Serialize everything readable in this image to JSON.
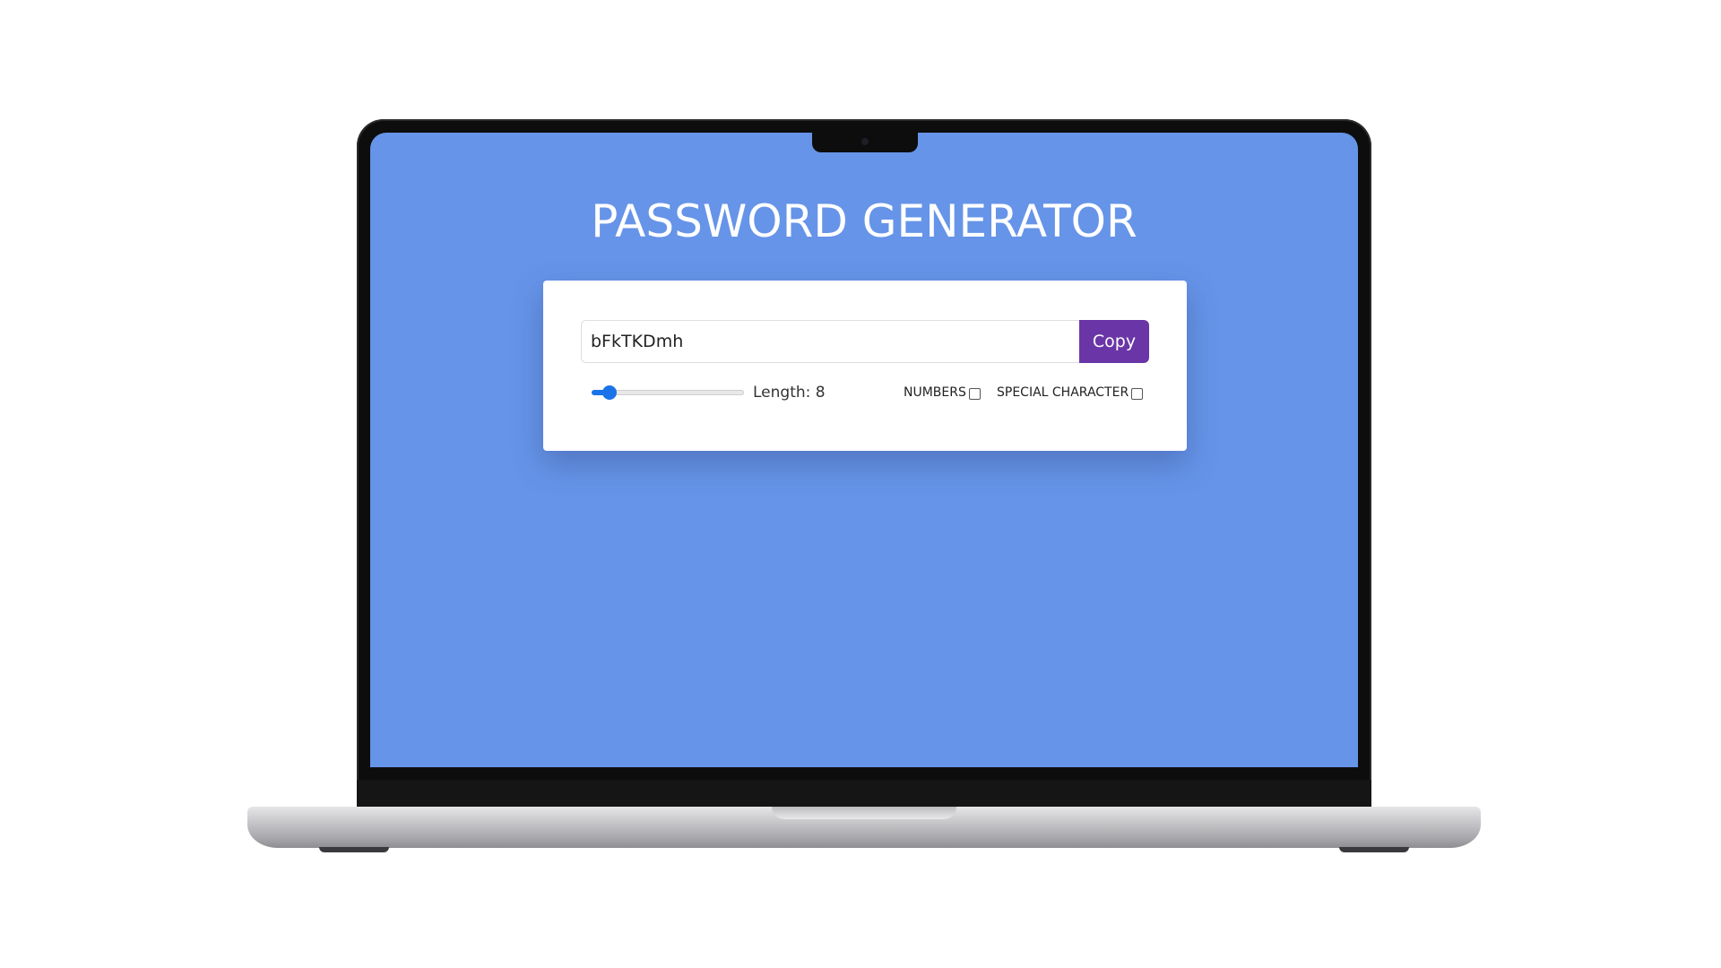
{
  "app": {
    "title": "PASSWORD GENERATOR"
  },
  "password": {
    "value": "bFkTKDmh",
    "copy_label": "Copy"
  },
  "length": {
    "label": "Length: 8",
    "value": 8,
    "slider_fraction": 0.08
  },
  "options": {
    "numbers_label": "NUMBERS",
    "numbers_checked": false,
    "special_label": "SPECIAL CHARACTER",
    "special_checked": false
  },
  "colors": {
    "screen_background": "#6694e8",
    "card_background": "#ffffff",
    "copy_button": "#6a35a6",
    "slider_accent": "#1a73e8"
  }
}
